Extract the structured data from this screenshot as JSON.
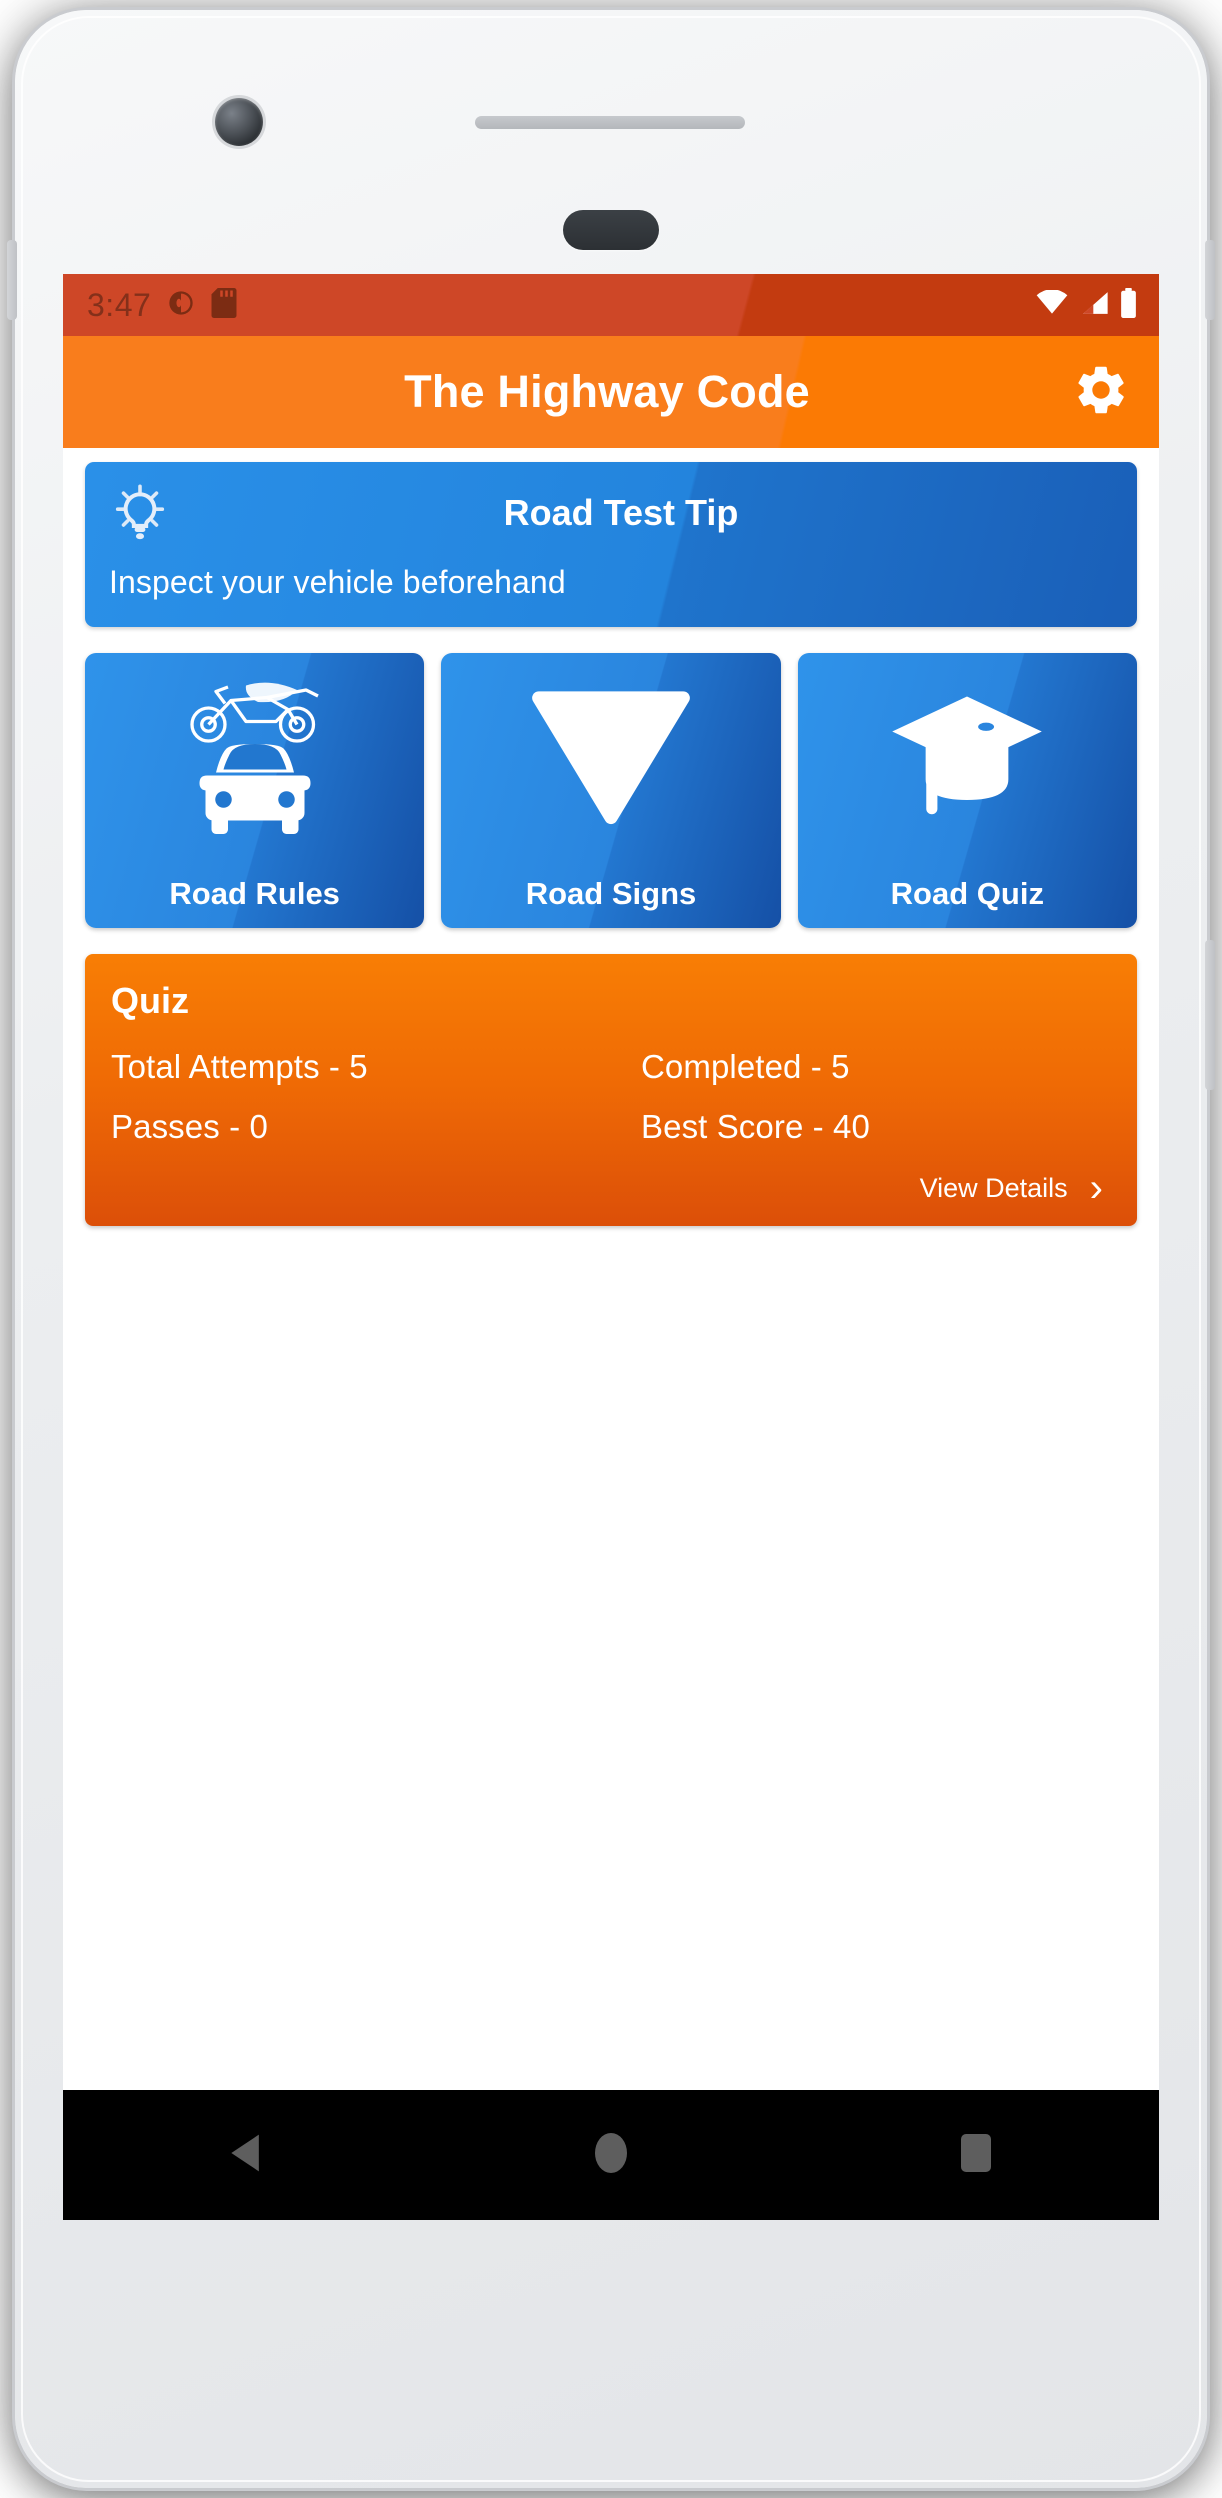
{
  "status_bar": {
    "clock": "3:47",
    "left_icons": [
      "do-not-disturb-icon",
      "sd-card-icon"
    ],
    "right_icons": [
      "wifi-icon",
      "cell-signal-icon",
      "battery-icon"
    ],
    "background_color": "#CE4727"
  },
  "app_bar": {
    "title": "The Highway Code",
    "settings_icon": "gear-icon",
    "background_color": "#F97D1C"
  },
  "tip_card": {
    "icon": "lightbulb-icon",
    "title": "Road Test Tip",
    "text": "Inspect your vehicle beforehand",
    "background_color": "#2384DD"
  },
  "tiles": [
    {
      "label": "Road Rules",
      "icon": "motorcycle-and-car-icon"
    },
    {
      "label": "Road Signs",
      "icon": "yield-triangle-icon"
    },
    {
      "label": "Road Quiz",
      "icon": "graduation-cap-icon"
    }
  ],
  "quiz_card": {
    "title": "Quiz",
    "stats": [
      {
        "label": "Total Attempts - 5"
      },
      {
        "label": "Completed - 5"
      },
      {
        "label": "Passes - 0"
      },
      {
        "label": "Best Score - 40"
      }
    ],
    "view_details_label": "View Details",
    "chevron": "›",
    "background_color": "#EF6A05"
  },
  "nav_bar": {
    "back_icon": "back-triangle-icon",
    "home_icon": "home-circle-icon",
    "recents_icon": "recents-square-icon"
  }
}
